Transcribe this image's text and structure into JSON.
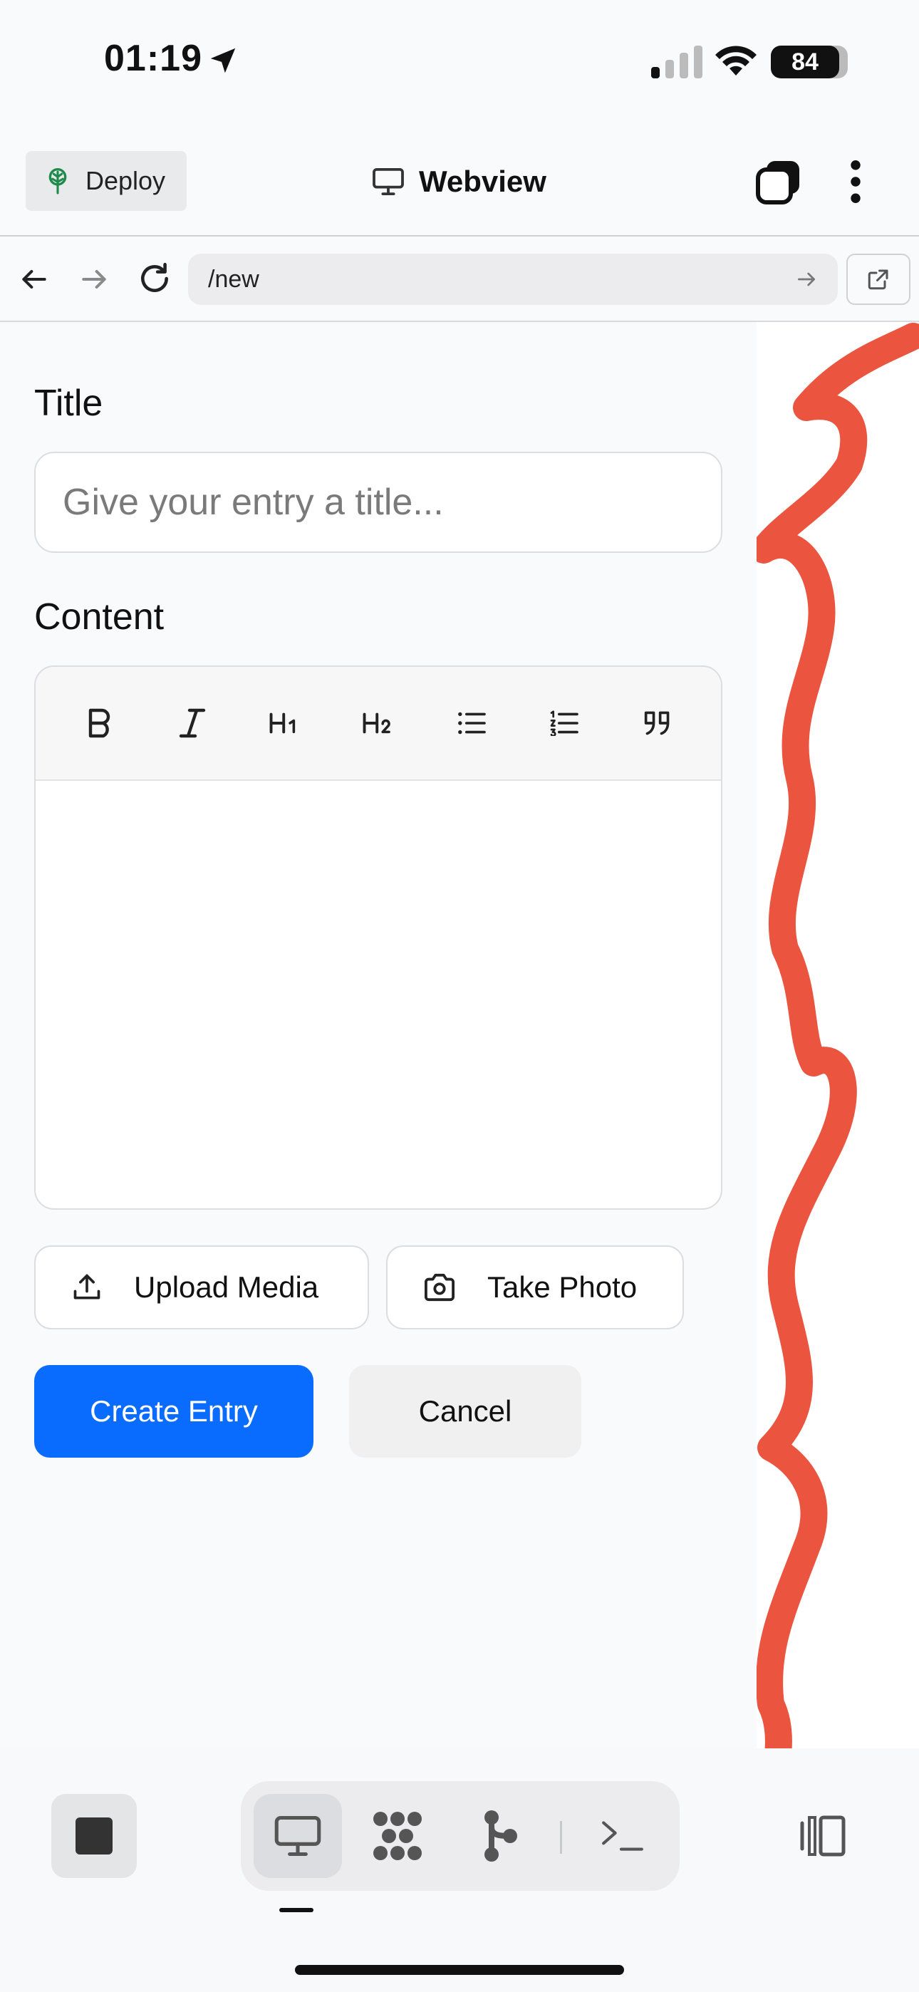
{
  "status_bar": {
    "time": "01:19",
    "battery": "84"
  },
  "header": {
    "deploy_label": "Deploy",
    "title": "Webview"
  },
  "url_bar": {
    "path": "/new"
  },
  "form": {
    "title_label": "Title",
    "title_placeholder": "Give your entry a title...",
    "title_value": "",
    "content_label": "Content",
    "toolbar": [
      "B",
      "I",
      "H1",
      "H2",
      "bullet-list",
      "ordered-list",
      "quote"
    ],
    "upload_label": "Upload Media",
    "photo_label": "Take Photo",
    "create_label": "Create Entry",
    "cancel_label": "Cancel"
  },
  "colors": {
    "primary": "#0a6cff",
    "annotation": "#e8361c"
  },
  "icons": [
    "location-arrow-icon",
    "signal-icon",
    "wifi-icon",
    "battery-icon",
    "tree-icon",
    "monitor-icon",
    "tabs-icon",
    "more-icon",
    "back-arrow-icon",
    "forward-arrow-icon",
    "reload-icon",
    "go-arrow-icon",
    "external-link-icon",
    "bold-icon",
    "italic-icon",
    "heading1-icon",
    "heading2-icon",
    "bullet-list-icon",
    "ordered-list-icon",
    "quote-icon",
    "upload-icon",
    "camera-icon",
    "stop-icon",
    "desktop-icon",
    "grid-dots-icon",
    "branch-icon",
    "terminal-icon",
    "panel-toggle-icon"
  ]
}
